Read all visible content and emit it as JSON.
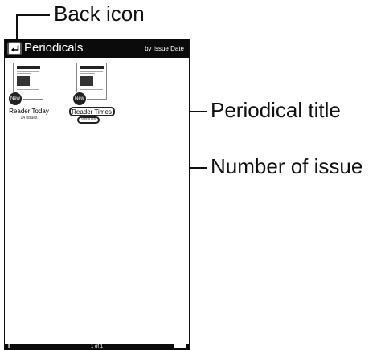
{
  "callouts": {
    "back_icon": "Back icon",
    "periodical_title": "Periodical title",
    "number_of_issue": "Number of issue"
  },
  "header": {
    "title": "Periodicals",
    "sort": "by Issue Date"
  },
  "periodicals": [
    {
      "title": "Reader Today",
      "issues": "14 issues",
      "badge": "New",
      "masthead": "Reader Today"
    },
    {
      "title": "Reader Times",
      "issues": "9 issues",
      "badge": "New",
      "masthead": "Reader Times"
    }
  ],
  "footer": {
    "page_indicator": "1 of 1"
  },
  "icons": {
    "back": "back-arrow-icon",
    "wifi": "wifi-icon",
    "battery": "battery-icon"
  }
}
